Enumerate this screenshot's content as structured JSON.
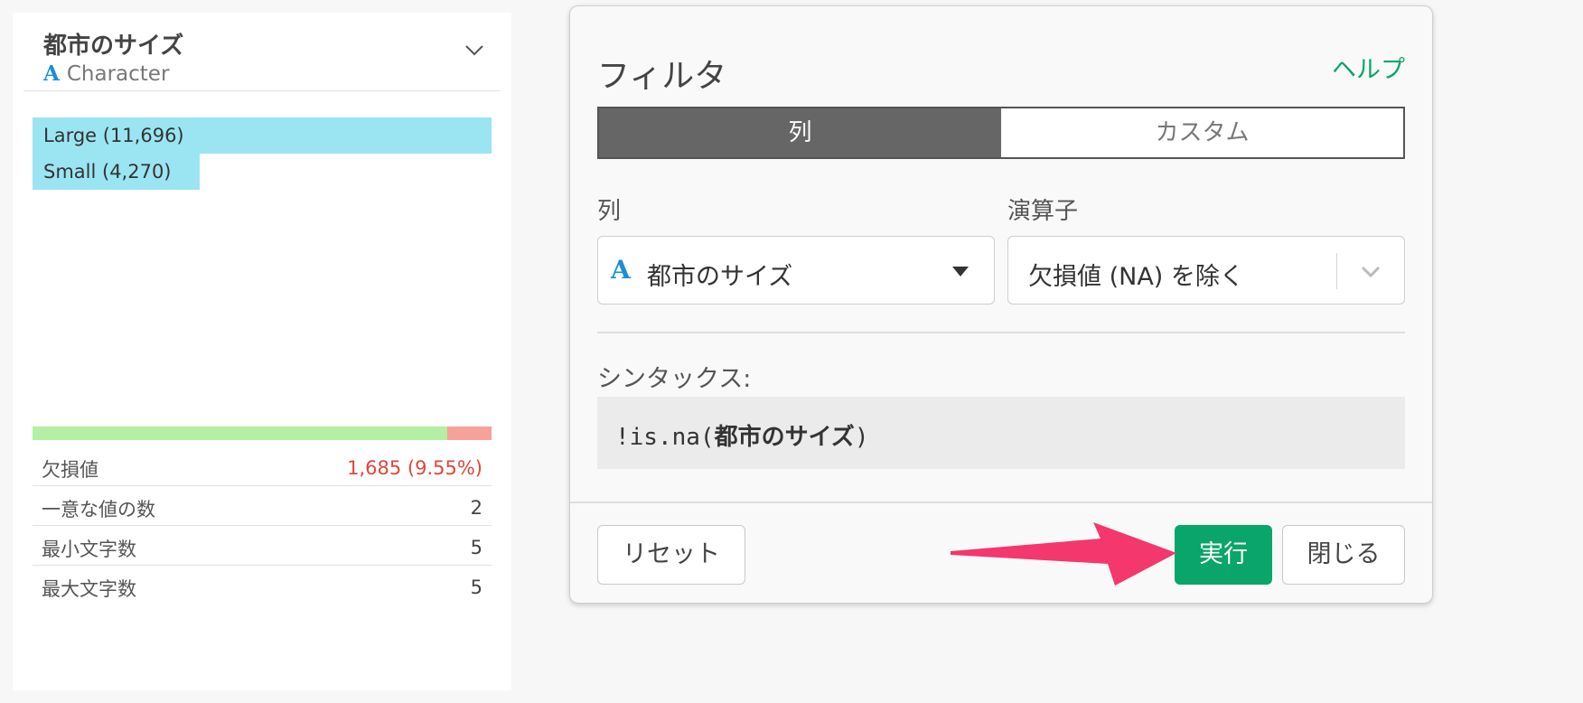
{
  "column_summary": {
    "name": "都市のサイズ",
    "type_icon": "A",
    "type": "Character",
    "bars": [
      {
        "label": "Large (11,696)",
        "value": 11696
      },
      {
        "label": "Small (4,270)",
        "value": 4270
      }
    ],
    "missing_ratio": 0.0955,
    "stats": [
      {
        "label": "欠損値",
        "value": "1,685 (9.55%)",
        "highlight": true
      },
      {
        "label": "一意な値の数",
        "value": "2"
      },
      {
        "label": "最小文字数",
        "value": "5"
      },
      {
        "label": "最大文字数",
        "value": "5"
      }
    ],
    "colors": {
      "bar": "#9be5f3",
      "ok": "#b3f0a4",
      "missing": "#f6a199"
    }
  },
  "filter_dialog": {
    "title": "フィルタ",
    "help_label": "ヘルプ",
    "tabs": [
      {
        "label": "列",
        "active": true
      },
      {
        "label": "カスタム",
        "active": false
      }
    ],
    "column_label": "列",
    "column_type_icon": "A",
    "column_value": "都市のサイズ",
    "operator_label": "演算子",
    "operator_value": "欠損値 (NA) を除く",
    "syntax_label": "シンタックス:",
    "syntax_prefix": "!is.na(",
    "syntax_arg": "都市のサイズ",
    "syntax_suffix": ")",
    "reset_label": "リセット",
    "run_label": "実行",
    "close_label": "閉じる",
    "accent_color": "#0aa56b",
    "annotation_arrow_color": "#f4376d"
  }
}
